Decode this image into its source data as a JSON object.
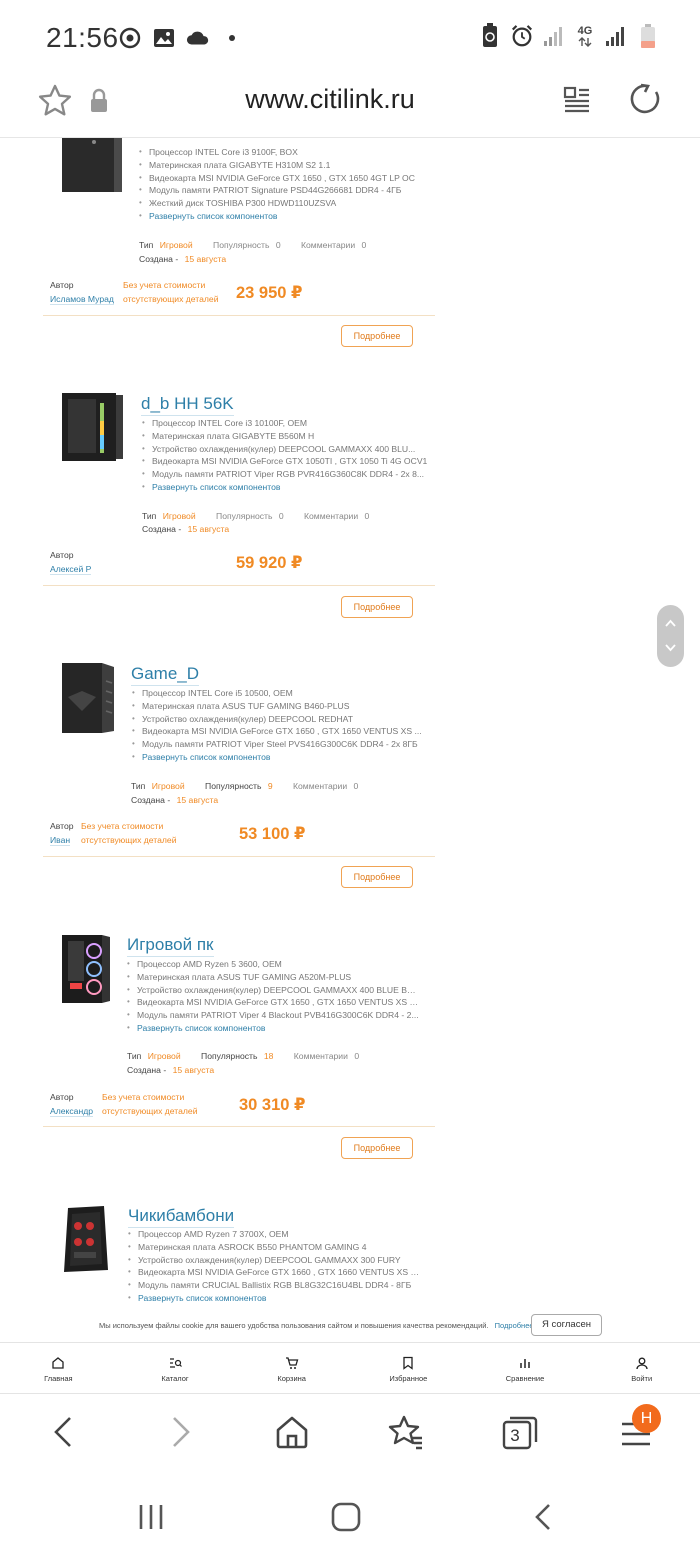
{
  "status_bar": {
    "time": "21:56",
    "network": "4G",
    "icons": [
      "sync-icon",
      "image-icon",
      "cloud-icon",
      "dot-icon",
      "battery-saver-icon",
      "alarm-icon",
      "signal-icon",
      "signal-icon",
      "battery-low-icon"
    ]
  },
  "browser": {
    "url": "www.citilink.ru",
    "tab_count": "3",
    "profile_initial": "Н"
  },
  "labels": {
    "type": "Тип",
    "popularity": "Популярность",
    "comments": "Комментарии",
    "created": "Создана -",
    "author": "Автор",
    "expand": "Развернуть список компонентов",
    "details": "Подробнее",
    "missing_note": "Без учета стоимости отсутствующих деталей"
  },
  "builds": [
    {
      "title": "",
      "components": [
        "Процессор INTEL Core i3 9100F, BOX",
        "Материнская плата GIGABYTE H310M S2 1.1",
        "Видеокарта MSI NVIDIA GeForce GTX 1650 , GTX 1650 4GT LP OC",
        "Модуль памяти PATRIOT Signature PSD44G266681 DDR4 - 4ГБ",
        "Жесткий диск TOSHIBA P300 HDWD110UZSVA"
      ],
      "type": "Игровой",
      "popularity": "0",
      "comments": "0",
      "created": "15 августа",
      "author": "Исламов Мурад",
      "price": "23 950 ₽"
    },
    {
      "title": "d_b HH 56K",
      "components": [
        "Процессор INTEL Core i3 10100F, OEM",
        "Материнская плата GIGABYTE B560M H",
        "Устройство охлаждения(кулер) DEEPCOOL GAMMAXX 400 BLU...",
        "Видеокарта MSI NVIDIA GeForce GTX 1050TI , GTX 1050 Ti 4G OCV1",
        "Модуль памяти PATRIOT Viper RGB PVR416G360C8K DDR4 - 2x 8..."
      ],
      "type": "Игровой",
      "popularity": "0",
      "comments": "0",
      "created": "15 августа",
      "author": "Алексей Р",
      "price": "59 920 ₽"
    },
    {
      "title": "Game_D",
      "components": [
        "Процессор INTEL Core i5 10500, OEM",
        "Материнская плата ASUS TUF GAMING B460-PLUS",
        "Устройство охлаждения(кулер) DEEPCOOL REDHAT",
        "Видеокарта MSI NVIDIA GeForce GTX 1650 , GTX 1650 VENTUS XS ...",
        "Модуль памяти PATRIOT Viper Steel PVS416G300C6K DDR4 - 2x 8ГБ"
      ],
      "type": "Игровой",
      "popularity": "9",
      "comments": "0",
      "created": "15 августа",
      "author": "Иван",
      "price": "53 100 ₽"
    },
    {
      "title": "Игровой пк",
      "components": [
        "Процессор AMD Ryzen 5 3600, OEM",
        "Материнская плата ASUS TUF GAMING A520M-PLUS",
        "Устройство охлаждения(кулер) DEEPCOOL GAMMAXX 400 BLUE BA...",
        "Видеокарта MSI NVIDIA GeForce GTX 1650 , GTX 1650 VENTUS XS 4...",
        "Модуль памяти PATRIOT Viper 4 Blackout PVB416G300C6K DDR4 - 2..."
      ],
      "type": "Игровой",
      "popularity": "18",
      "comments": "0",
      "created": "15 августа",
      "author": "Александр",
      "price": "30 310 ₽"
    },
    {
      "title": "Чикибамбони",
      "components": [
        "Процессор AMD Ryzen 7 3700X, OEM",
        "Материнская плата ASROCK B550 PHANTOM GAMING 4",
        "Устройство охлаждения(кулер) DEEPCOOL GAMMAXX 300 FURY",
        "Видеокарта MSI NVIDIA GeForce GTX 1660 , GTX 1660 VENTUS XS 6...",
        "Модуль памяти CRUCIAL Ballistix RGB BL8G32C16U4BL DDR4 - 8ГБ"
      ]
    }
  ],
  "cookie": {
    "text": "Мы используем файлы cookie для вашего удобства пользования сайтом и повышения качества рекомендаций.",
    "more": "Подробнее",
    "accept": "Я согласен"
  },
  "site_nav": [
    {
      "label": "Главная",
      "icon": "home-icon"
    },
    {
      "label": "Каталог",
      "icon": "catalog-icon"
    },
    {
      "label": "Корзина",
      "icon": "cart-icon"
    },
    {
      "label": "Избранное",
      "icon": "bookmark-icon"
    },
    {
      "label": "Сравнение",
      "icon": "compare-icon"
    },
    {
      "label": "Войти",
      "icon": "user-icon"
    }
  ],
  "colors": {
    "accent_orange": "#f08a24",
    "link_blue": "#2e7fa8",
    "profile_badge": "#f26b1d"
  }
}
